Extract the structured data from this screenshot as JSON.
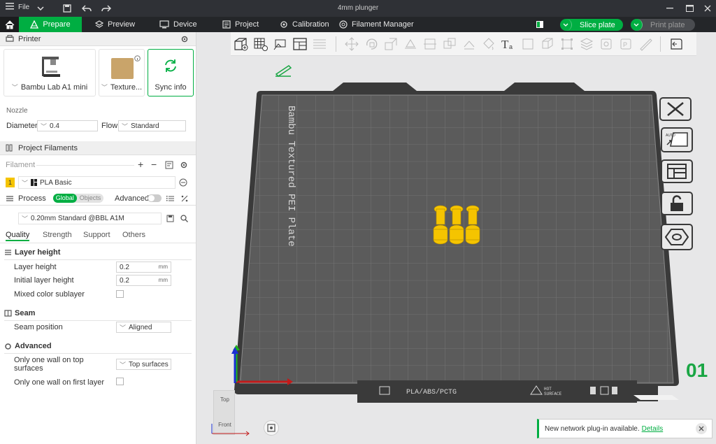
{
  "titlebar": {
    "menu_label": "File",
    "title": "4mm plunger"
  },
  "nav": {
    "tabs": [
      {
        "label": "Prepare"
      },
      {
        "label": "Preview"
      },
      {
        "label": "Device"
      },
      {
        "label": "Project"
      },
      {
        "label": "Calibration"
      },
      {
        "label": "Filament Manager"
      }
    ],
    "slice_label": "Slice plate",
    "print_label": "Print plate"
  },
  "printer": {
    "header": "Printer",
    "printer_name": "Bambu Lab A1 mini",
    "plate_name": "Texture...",
    "sync_label": "Sync info",
    "nozzle_label": "Nozzle",
    "diameter_label": "Diameter",
    "diameter_value": "0.4",
    "flow_label": "Flow",
    "flow_value": "Standard"
  },
  "filaments": {
    "header": "Project Filaments",
    "filament_label": "Filament",
    "items": [
      {
        "index": "1",
        "name": "PLA Basic",
        "color": "#f5c400"
      }
    ]
  },
  "process": {
    "header": "Process",
    "global_label": "Global",
    "objects_label": "Objects",
    "advanced_label": "Advanced",
    "preset": "0.20mm Standard @BBL A1M",
    "tabs": [
      "Quality",
      "Strength",
      "Support",
      "Others"
    ],
    "layer_height_group": "Layer height",
    "layer_height_label": "Layer height",
    "layer_height_value": "0.2",
    "initial_layer_label": "Initial layer height",
    "initial_layer_value": "0.2",
    "unit": "mm",
    "mixed_color_label": "Mixed color sublayer",
    "seam_group": "Seam",
    "seam_position_label": "Seam position",
    "seam_position_value": "Aligned",
    "advanced_group": "Advanced",
    "one_wall_top_label_1": "Only one wall on top",
    "one_wall_top_label_2": "surfaces",
    "one_wall_top_value": "Top surfaces",
    "one_wall_first_label": "Only one wall on first layer"
  },
  "viewport": {
    "plate_name": "Bambu Textured PEI Plate",
    "plate_footer": "PLA/ABS/PCTG",
    "hot_label_1": "HOT",
    "hot_label_2": "SURFACE",
    "plate_number": "01",
    "view_top": "Top",
    "view_front": "Front"
  },
  "toast": {
    "text": "New network plug-in available.",
    "link": "Details"
  },
  "colors": {
    "accent": "#00ae42",
    "filament": "#f5c400"
  }
}
